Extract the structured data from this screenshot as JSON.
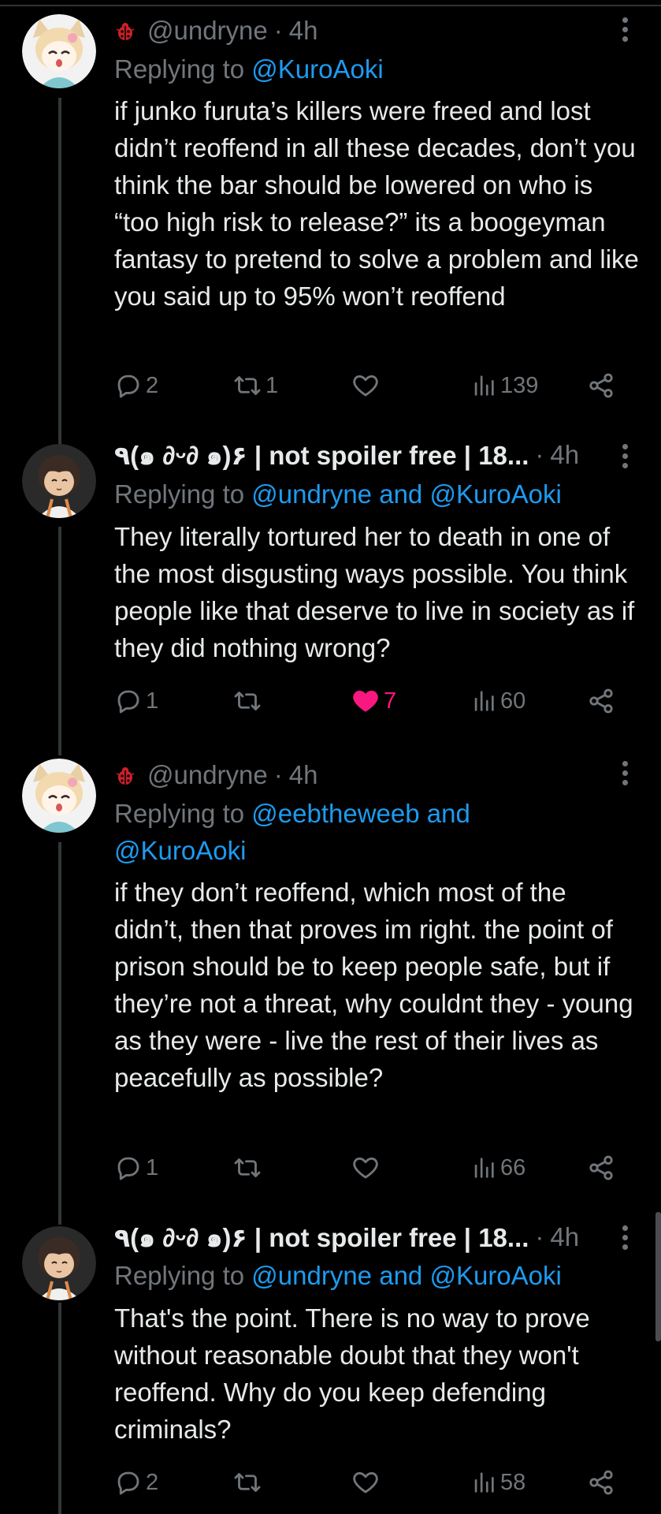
{
  "replying_prefix": "Replying to",
  "tweets": [
    {
      "handle": "@undryne",
      "display_name": "",
      "separator": "·",
      "time": "4h",
      "reply_mentions": [
        "@KuroAoki"
      ],
      "reply_joiner": "",
      "text": "if junko furuta’s killers were freed and lost didn’t reoffend in all these decades, don’t you think the bar should be lowered on who is “too high risk to release?” its a boogeyman fantasy to pretend to solve a problem and like you said up to 95% won’t reoffend",
      "replies": "2",
      "retweets": "1",
      "likes": "",
      "liked": false,
      "views": "139",
      "icons": {
        "reply": "reply-icon",
        "retweet": "retweet-icon",
        "like": "heart-icon",
        "views": "views-icon",
        "share": "share-icon"
      }
    },
    {
      "handle": "",
      "display_name": "٩(๑ ∂ᵕ∂ ๑)۶ | not spoiler free | 18...",
      "separator": "·",
      "time": "4h",
      "reply_mentions": [
        "@undryne",
        "@KuroAoki"
      ],
      "reply_joiner": "and",
      "text": "They literally tortured her to death in one of the most disgusting ways possible. You think people like that deserve to live in society as if they did nothing wrong?",
      "replies": "1",
      "retweets": "",
      "likes": "7",
      "liked": true,
      "views": "60"
    },
    {
      "handle": "@undryne",
      "display_name": "",
      "separator": "·",
      "time": "4h",
      "reply_mentions": [
        "@eebtheweeb",
        "@KuroAoki"
      ],
      "reply_joiner": "and",
      "text": "if they don’t reoffend, which most of the didn’t, then that proves im right. the point of prison should be to keep people safe, but if they’re not a threat, why couldnt they - young as they were - live the rest of their lives as peacefully as possible?",
      "replies": "1",
      "retweets": "",
      "likes": "",
      "liked": false,
      "views": "66"
    },
    {
      "handle": "",
      "display_name": "٩(๑ ∂ᵕ∂ ๑)۶ | not spoiler free | 18...",
      "separator": "·",
      "time": "4h",
      "reply_mentions": [
        "@undryne",
        "@KuroAoki"
      ],
      "reply_joiner": "and",
      "text": "That's the point. There is no way to prove without reasonable doubt that they won't reoffend. Why do you keep defending criminals?",
      "replies": "2",
      "retweets": "",
      "likes": "",
      "liked": false,
      "views": "58"
    }
  ],
  "colors": {
    "background": "#000000",
    "text": "#e7e9ea",
    "muted": "#71767b",
    "mention": "#1d9bf0",
    "like_active": "#f91880",
    "thread_line": "#333639",
    "ladybug": "#d0202a"
  }
}
